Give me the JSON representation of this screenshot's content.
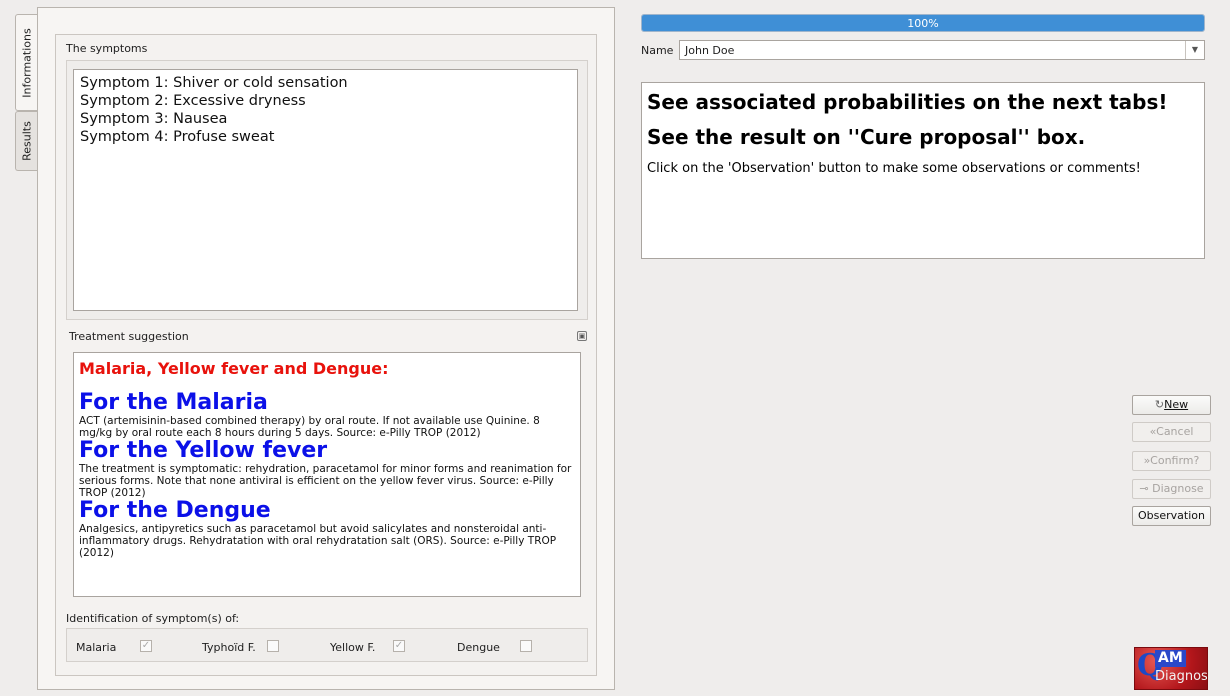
{
  "tabs": [
    {
      "label": "Informations",
      "active": true
    },
    {
      "label": "Results",
      "active": false
    }
  ],
  "symptoms": {
    "title": "The symptoms",
    "lines": [
      "Symptom 1: Shiver or cold sensation",
      "Symptom 2: Excessive dryness",
      "Symptom 3: Nausea",
      "Symptom 4: Profuse sweat"
    ]
  },
  "treatment": {
    "title": "Treatment suggestion",
    "heading": "Malaria, Yellow fever and Dengue:",
    "diseases": [
      {
        "title": "For the Malaria",
        "text": "ACT (artemisinin-based combined therapy) by oral route. If not available use Quinine. 8 mg/kg by oral route each 8 hours during 5 days. Source: e-Pilly TROP (2012)"
      },
      {
        "title": "For the Yellow fever",
        "text": "The treatment is symptomatic: rehydration, paracetamol for minor forms and reanimation for serious forms. Note that none antiviral is efficient on the yellow fever virus. Source: e-Pilly TROP (2012)"
      },
      {
        "title": "For the Dengue",
        "text": "Analgesics, antipyretics such as paracetamol but avoid salicylates and nonsteroidal anti-inflammatory drugs. Rehydratation with oral rehydratation salt (ORS). Source: e-Pilly TROP (2012)"
      }
    ]
  },
  "identification": {
    "title": "Identification of symptom(s) of:",
    "items": [
      {
        "label": "Malaria",
        "checked": true
      },
      {
        "label": "Typhoïd F.",
        "checked": false
      },
      {
        "label": "Yellow F.",
        "checked": true
      },
      {
        "label": "Dengue",
        "checked": false
      }
    ]
  },
  "progress": {
    "value": 1.0,
    "text": "100%"
  },
  "name_field": {
    "label": "Name",
    "value": "John Doe"
  },
  "info": {
    "line1": "See associated probabilities on the next tabs!",
    "line2": "See the result on ''Cure proposal'' box.",
    "line3": "Click on the 'Observation' button to make some observations or comments!"
  },
  "buttons": {
    "new": "New",
    "cancel": "Cancel",
    "confirm": "Confirm?",
    "diagnose": "Diagnose",
    "observation": "Observation"
  },
  "logo": {
    "q": "Q",
    "am": "AM",
    "diagnos": "Diagnos"
  },
  "colors": {
    "progress": "#3f8fd6",
    "heading_red": "#e8120c",
    "disease_blue": "#0b10e8"
  }
}
